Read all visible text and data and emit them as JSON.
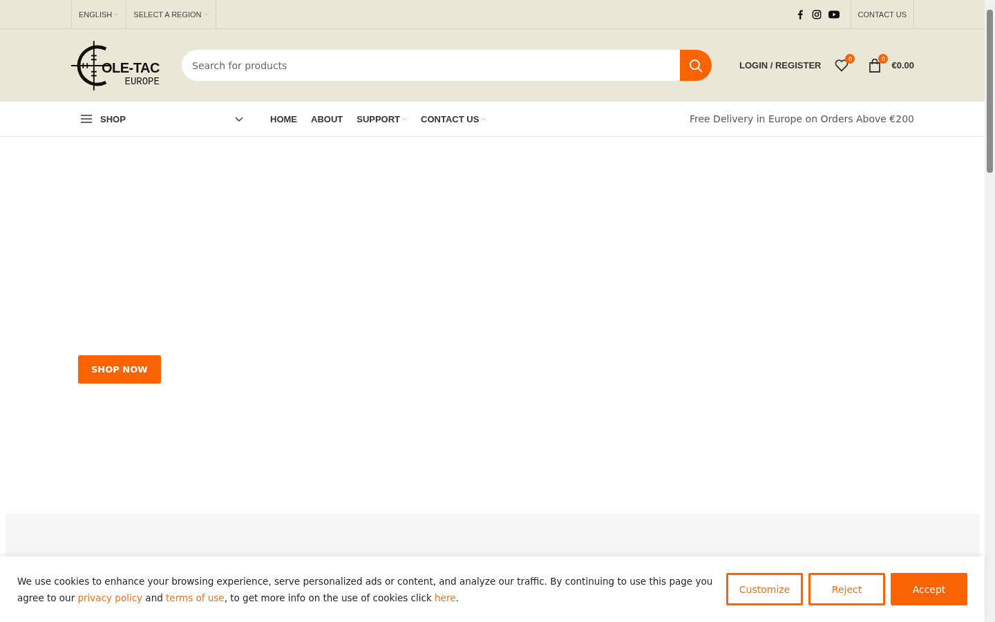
{
  "top_bar": {
    "language": "ENGLISH",
    "region": "SELECT A REGION",
    "contact": "CONTACT US"
  },
  "header": {
    "logo": {
      "main": "OLE-TAC",
      "sub": "EUROPE"
    },
    "search": {
      "placeholder": "Search for products"
    },
    "login": "LOGIN / REGISTER",
    "wishlist_count": "0",
    "cart_count": "0",
    "cart_total": "€0.00"
  },
  "nav": {
    "shop": "SHOP",
    "items": [
      {
        "label": "HOME",
        "has_menu": false
      },
      {
        "label": "ABOUT",
        "has_menu": false
      },
      {
        "label": "SUPPORT",
        "has_menu": true
      },
      {
        "label": "CONTACT US",
        "has_menu": true
      }
    ],
    "promo": "Free Delivery in Europe on Orders Above €200"
  },
  "hero": {
    "button": "SHOP NOW"
  },
  "cookie_banner": {
    "text": "We use cookies to enhance your browsing experience, serve personalized ads or content, and analyze our traffic. By continuing to use this page you agree to our ",
    "link_1": "privacy policy",
    "middle": " and ",
    "link_2": "terms of use",
    "after": ", to get more info on the use of cookies click ",
    "link_3": "here",
    "end": ".",
    "buttons": [
      {
        "label": "Customize",
        "kind": "outline"
      },
      {
        "label": "Reject",
        "kind": "outline"
      },
      {
        "label": "Accept",
        "kind": "filled"
      }
    ]
  }
}
